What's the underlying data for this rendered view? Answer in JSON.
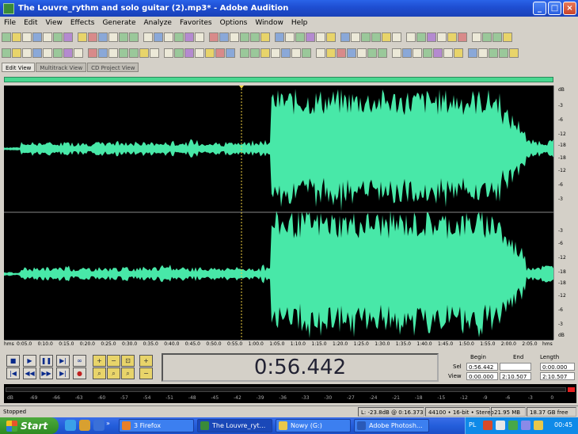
{
  "window": {
    "title": "The Louvre_rythm and solo guitar (2).mp3* - Adobe Audition"
  },
  "menu": [
    "File",
    "Edit",
    "View",
    "Effects",
    "Generate",
    "Analyze",
    "Favorites",
    "Options",
    "Window",
    "Help"
  ],
  "view_tabs": [
    "Edit View",
    "Multitrack View",
    "CD Project View"
  ],
  "db_scale": {
    "top": [
      "dB",
      "-3",
      "-6",
      "-12",
      "-18",
      "-18",
      "-12",
      "-6",
      "-3"
    ],
    "bottom": [
      "-3",
      "-6",
      "-12",
      "-18",
      "-18",
      "-12",
      "-6",
      "-3",
      "dB"
    ]
  },
  "time_ruler": {
    "unit": "hms",
    "labels": [
      "0:05.0",
      "0:10.0",
      "0:15.0",
      "0:20.0",
      "0:25.0",
      "0:30.0",
      "0:35.0",
      "0:40.0",
      "0:45.0",
      "0:50.0",
      "0:55.0",
      "1:00.0",
      "1:05.0",
      "1:10.0",
      "1:15.0",
      "1:20.0",
      "1:25.0",
      "1:30.0",
      "1:35.0",
      "1:40.0",
      "1:45.0",
      "1:50.0",
      "1:55.0",
      "2:00.0",
      "2:05.0"
    ],
    "end_label": "hms"
  },
  "transport": {
    "icons": [
      "stop-icon",
      "play-icon",
      "pause-icon",
      "play-to-end-icon",
      "loop-icon",
      "go-to-start-icon",
      "rewind-icon",
      "fast-forward-icon",
      "go-to-end-icon",
      "record-icon"
    ]
  },
  "time_display": "0:56.442",
  "selection": {
    "headers": [
      "Begin",
      "End",
      "Length"
    ],
    "sel_label": "Sel",
    "view_label": "View",
    "sel": [
      "0:56.442",
      "",
      "0:00.000"
    ],
    "view": [
      "0:00.000",
      "2:10.507",
      "2:10.507"
    ]
  },
  "level_meter": {
    "labels": [
      "dB",
      "-69",
      "-66",
      "-63",
      "-60",
      "-57",
      "-54",
      "-51",
      "-48",
      "-45",
      "-42",
      "-39",
      "-36",
      "-33",
      "-30",
      "-27",
      "-24",
      "-21",
      "-18",
      "-15",
      "-12",
      "-9",
      "-6",
      "-3",
      "0"
    ]
  },
  "status": {
    "state": "Stopped",
    "level": "L: -23.8dB @ 0:16.373",
    "format": "44100 • 16-bit • Stereo",
    "size": "21.95 MB",
    "free": "18.37 GB free"
  },
  "taskbar": {
    "start": "Start",
    "items": [
      {
        "label": "3 Firefox",
        "icon": "firefox-icon"
      },
      {
        "label": "The Louvre_ryt...",
        "icon": "audition-icon"
      },
      {
        "label": "Nowy (G:)",
        "icon": "folder-icon"
      },
      {
        "label": "Adobe Photosh...",
        "icon": "photoshop-icon"
      }
    ],
    "lang": "PL",
    "clock": "00:45"
  },
  "colors": {
    "waveform": "#48e8a8",
    "background": "#000000",
    "overview": "#48d890"
  }
}
